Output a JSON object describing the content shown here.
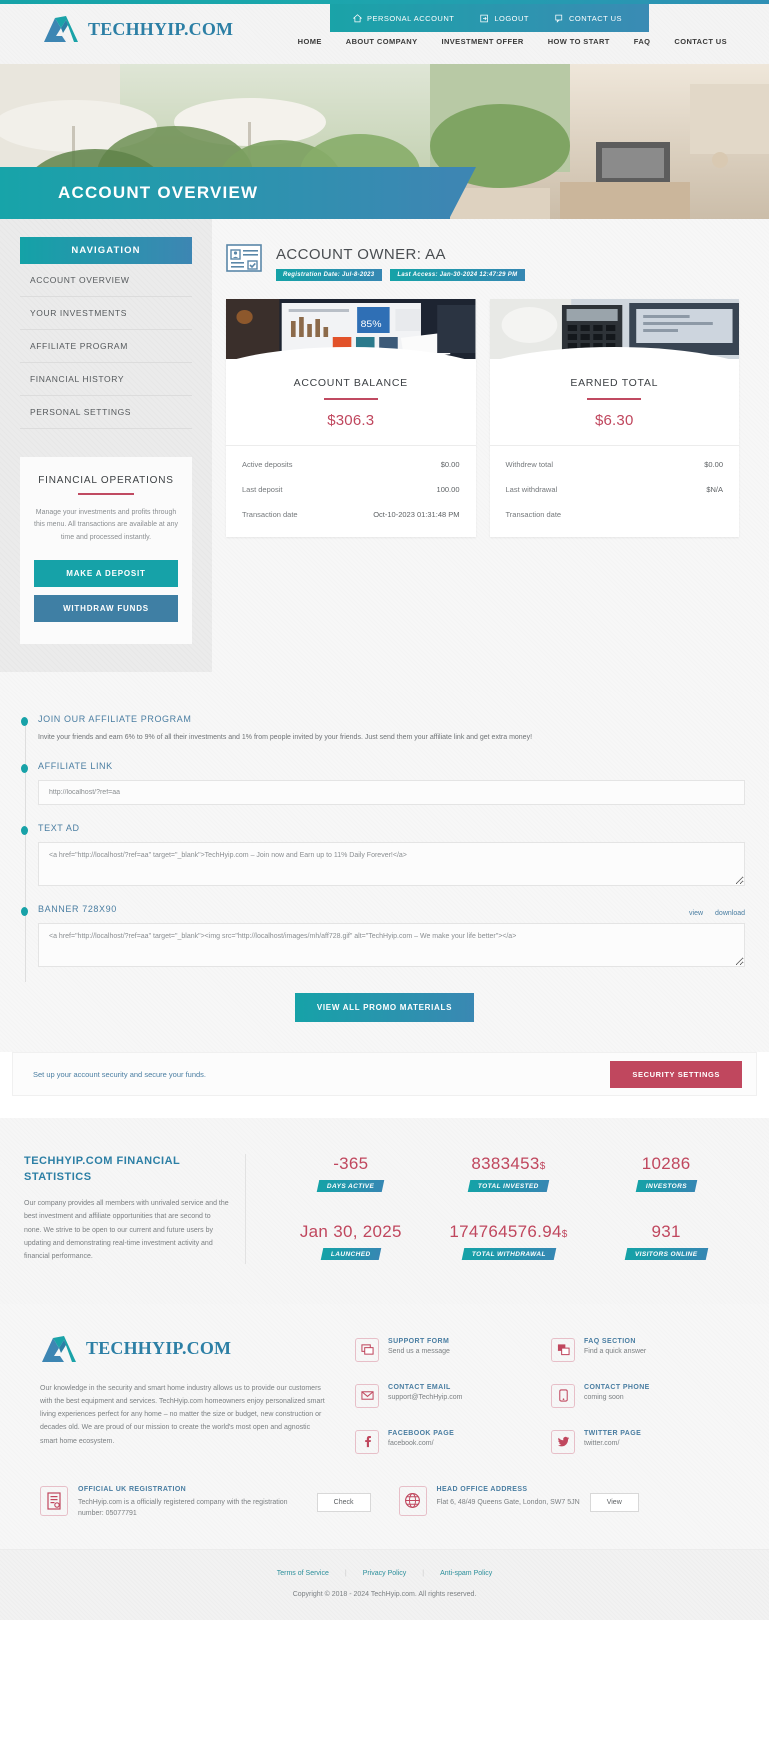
{
  "brand": {
    "name": "TECHHYIP.COM"
  },
  "account_nav": [
    {
      "label": "PERSONAL ACCOUNT",
      "icon": "home-icon"
    },
    {
      "label": "LOGOUT",
      "icon": "logout-icon"
    },
    {
      "label": "CONTACT US",
      "icon": "chat-icon"
    }
  ],
  "main_nav": [
    "HOME",
    "ABOUT COMPANY",
    "INVESTMENT OFFER",
    "HOW TO START",
    "FAQ",
    "CONTACT US"
  ],
  "hero": {
    "title": "ACCOUNT OVERVIEW"
  },
  "sidebar": {
    "heading": "NAVIGATION",
    "items": [
      {
        "label": "ACCOUNT OVERVIEW"
      },
      {
        "label": "YOUR INVESTMENTS"
      },
      {
        "label": "AFFILIATE PROGRAM"
      },
      {
        "label": "FINANCIAL HISTORY"
      },
      {
        "label": "PERSONAL SETTINGS"
      }
    ],
    "financial_operations": {
      "title": "FINANCIAL OPERATIONS",
      "description": "Manage your investments and profits through this menu. All transactions are available at any time and processed instantly.",
      "deposit_label": "MAKE A DEPOSIT",
      "withdraw_label": "WITHDRAW FUNDS"
    }
  },
  "owner": {
    "title": "ACCOUNT OWNER: AA",
    "registration_badge": "Registration Date: Jul-8-2023",
    "last_access_badge": "Last Access: Jan-30-2024 12:47:29 PM"
  },
  "cards": [
    {
      "title": "ACCOUNT BALANCE",
      "amount": "$306.3",
      "rows": [
        {
          "label": "Active deposits",
          "value": "$0.00"
        },
        {
          "label": "Last deposit",
          "value": "100.00"
        },
        {
          "label": "Transaction date",
          "value": "Oct-10-2023 01:31:48 PM"
        }
      ]
    },
    {
      "title": "EARNED TOTAL",
      "amount": "$6.30",
      "rows": [
        {
          "label": "Withdrew total",
          "value": "$0.00"
        },
        {
          "label": "Last withdrawal",
          "value": "$N/A"
        },
        {
          "label": "Transaction date",
          "value": ""
        }
      ]
    }
  ],
  "affiliate": {
    "join_label": "JOIN OUR AFFILIATE PROGRAM",
    "join_desc": "Invite your friends and earn 6% to 9% of all their investments and 1% from people invited by your friends. Just send them your affiliate link and get extra money!",
    "link_label": "AFFILIATE LINK",
    "link_value": "http://localhost/?ref=aa",
    "textad_label": "TEXT AD",
    "textad_value": "<a href=\"http://localhost/?ref=aa\" target=\"_blank\">TechHyip.com – Join now and Earn up to 11% Daily Forever!</a>",
    "banner_label": "BANNER 728X90",
    "banner_view": "view",
    "banner_download": "download",
    "banner_value": "<a href=\"http://localhost/?ref=aa\" target=\"_blank\"><img src=\"http://localhost/images/mh/aff728.gif\" alt=\"TechHyip.com – We make your life better\"></a>",
    "promo_button": "VIEW ALL PROMO MATERIALS"
  },
  "security": {
    "text": "Set up your account security and secure your funds.",
    "button": "SECURITY SETTINGS"
  },
  "statistics": {
    "heading": "TECHHYIP.COM FINANCIAL STATISTICS",
    "description": "Our company provides all members with unrivaled service and the best investment and affiliate opportunities that are second to none. We strive to be open to our current and future users by updating and demonstrating real-time investment activity and financial performance.",
    "items": [
      {
        "value": "-365",
        "currency": "",
        "label": "DAYS ACTIVE"
      },
      {
        "value": "8383453",
        "currency": "$",
        "label": "TOTAL INVESTED"
      },
      {
        "value": "10286",
        "currency": "",
        "label": "INVESTORS"
      },
      {
        "value": "Jan 30, 2025",
        "currency": "",
        "label": "LAUNCHED"
      },
      {
        "value": "174764576.94",
        "currency": "$",
        "label": "TOTAL WITHDRAWAL"
      },
      {
        "value": "931",
        "currency": "",
        "label": "VISITORS ONLINE"
      }
    ]
  },
  "footer": {
    "about": "Our knowledge in the security and smart home industry allows us to provide our customers with the best equipment and services. TechHyip.com homeowners enjoy personalized smart living experiences perfect for any home – no matter the size or budget, new construction or decades old. We are proud of our mission to create the world's most open and agnostic smart home ecosystem.",
    "links": [
      {
        "icon": "support-icon",
        "title": "SUPPORT FORM",
        "sub": "Send us a message"
      },
      {
        "icon": "faq-icon",
        "title": "FAQ SECTION",
        "sub": "Find a quick answer"
      },
      {
        "icon": "mail-icon",
        "title": "CONTACT EMAIL",
        "sub": "support@TechHyip.com"
      },
      {
        "icon": "phone-icon",
        "title": "CONTACT PHONE",
        "sub": "coming soon"
      },
      {
        "icon": "facebook-icon",
        "title": "FACEBOOK PAGE",
        "sub": "facebook.com/"
      },
      {
        "icon": "twitter-icon",
        "title": "TWITTER PAGE",
        "sub": "twitter.com/"
      }
    ],
    "registration": {
      "title": "OFFICIAL UK REGISTRATION",
      "text": "TechHyip.com is a officially registered company with the registration number: 05077791",
      "button": "Check"
    },
    "address": {
      "title": "HEAD OFFICE ADDRESS",
      "text": "Flat 6, 48/49 Queens Gate, London, SW7 5JN",
      "button": "View"
    },
    "legal": [
      "Terms of Service",
      "Privacy Policy",
      "Anti-spam Policy"
    ],
    "copyright": "Copyright © 2018 - 2024 TechHyip.com. All rights reserved."
  },
  "colors": {
    "teal": "#16a2a8",
    "blue": "#3a88b3",
    "crimson": "#c0475e",
    "link_blue": "#4a7ea2"
  }
}
